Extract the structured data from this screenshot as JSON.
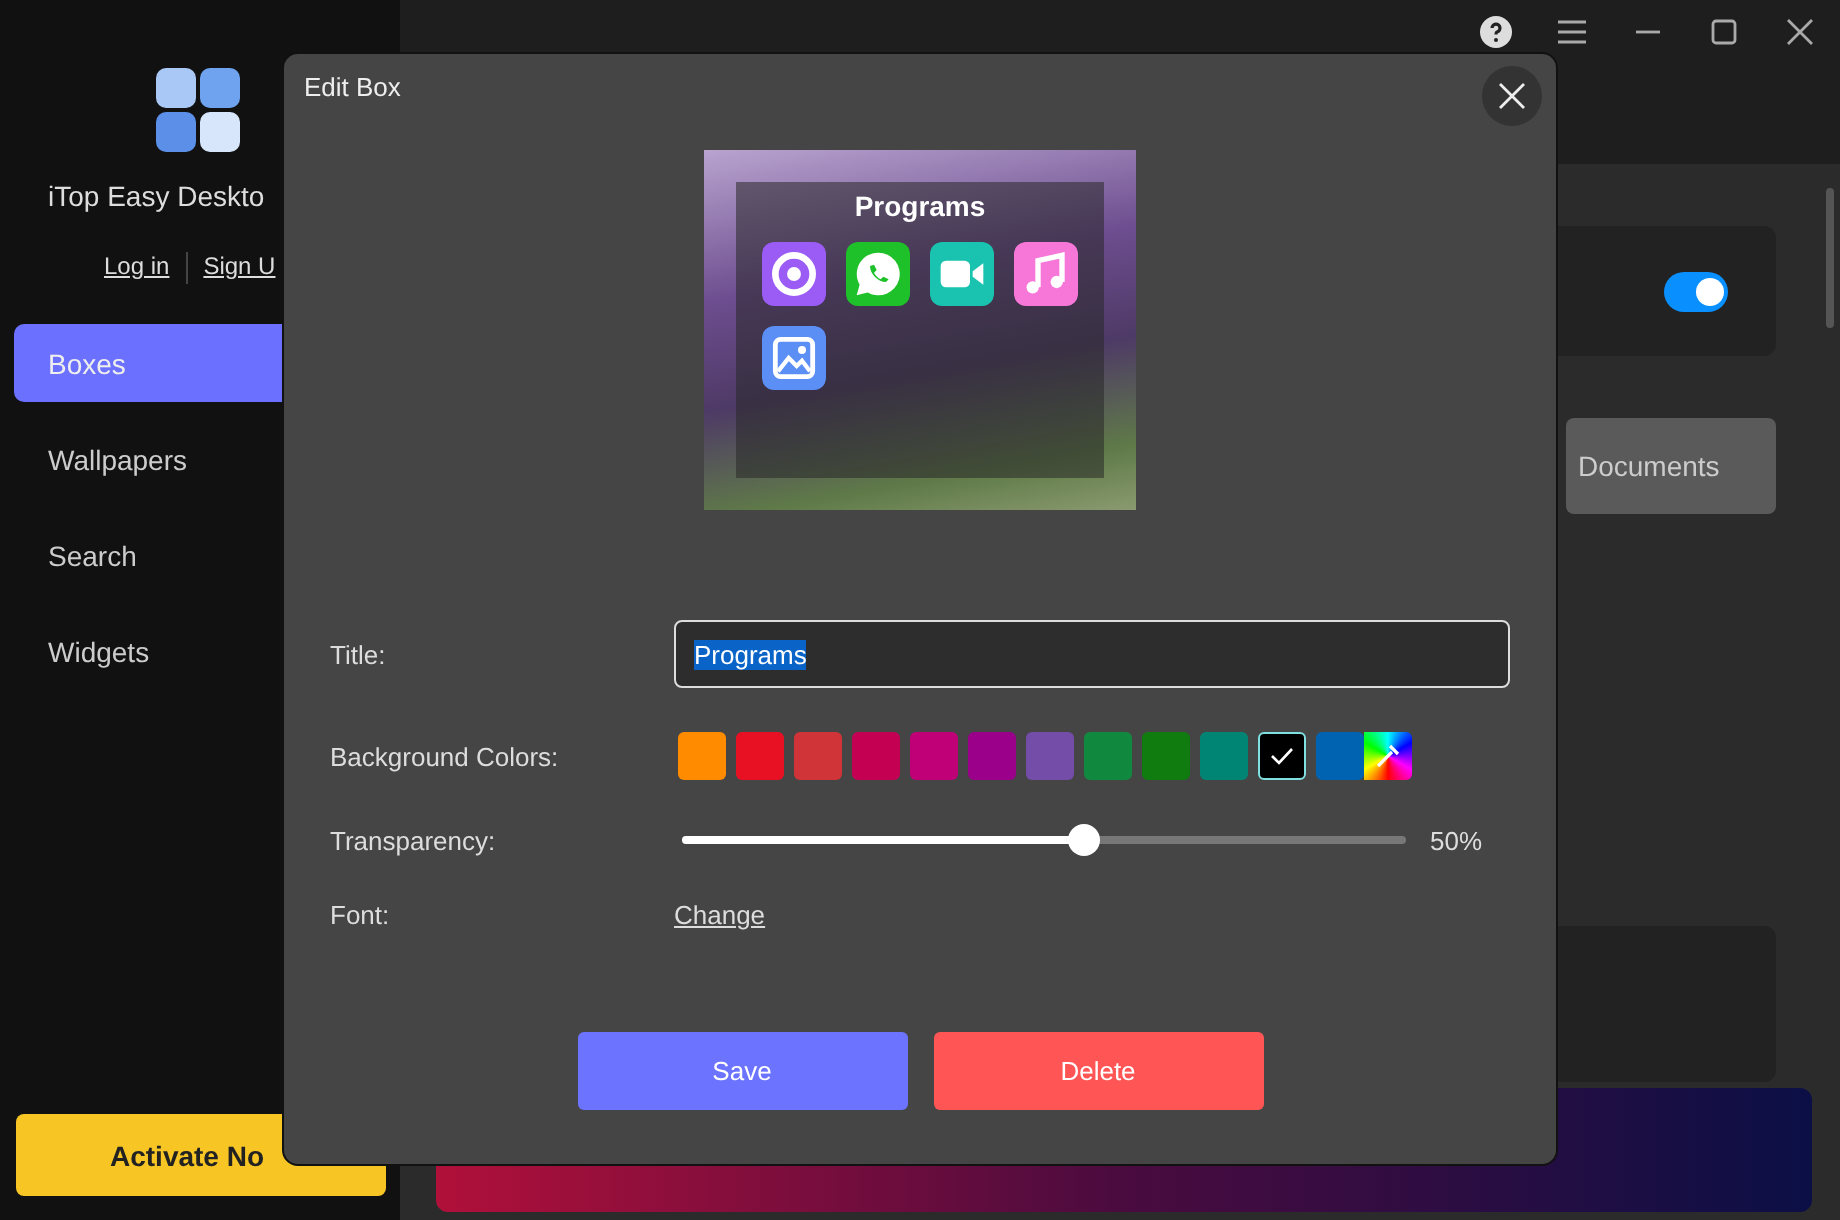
{
  "app": {
    "name": "iTop Easy Deskto",
    "login": "Log in",
    "signup": "Sign U",
    "nav": [
      {
        "label": "Boxes",
        "selected": true
      },
      {
        "label": "Wallpapers",
        "selected": false
      },
      {
        "label": "Search",
        "selected": false
      },
      {
        "label": "Widgets",
        "selected": false
      }
    ],
    "activate_button": "Activate No",
    "toggle": {
      "on": true
    },
    "documents_button": "Documents"
  },
  "dialog": {
    "title": "Edit Box",
    "preview": {
      "title": "Programs",
      "icons": [
        {
          "kind": "ring",
          "color": "#9b5cf5"
        },
        {
          "kind": "chat",
          "color": "#1fc12a"
        },
        {
          "kind": "video",
          "color": "#19c3b0"
        },
        {
          "kind": "music",
          "color": "#f777d9"
        },
        {
          "kind": "picture",
          "color": "#5b8ff5"
        }
      ]
    },
    "title_label": "Title:",
    "title_value": "Programs",
    "title_text_selected": true,
    "colors_label": "Background Colors:",
    "swatches": [
      {
        "kind": "solid",
        "color": "#ff8c00",
        "selected": false
      },
      {
        "kind": "solid",
        "color": "#e81123",
        "selected": false
      },
      {
        "kind": "solid",
        "color": "#d13438",
        "selected": false
      },
      {
        "kind": "solid",
        "color": "#c30052",
        "selected": false
      },
      {
        "kind": "solid",
        "color": "#bf0077",
        "selected": false
      },
      {
        "kind": "solid",
        "color": "#9a0089",
        "selected": false
      },
      {
        "kind": "solid",
        "color": "#744da9",
        "selected": false
      },
      {
        "kind": "solid",
        "color": "#10893e",
        "selected": false
      },
      {
        "kind": "solid",
        "color": "#107c10",
        "selected": false
      },
      {
        "kind": "solid",
        "color": "#008575",
        "selected": false
      },
      {
        "kind": "solid",
        "color": "#000000",
        "selected": true
      },
      {
        "kind": "solid",
        "color": "#0063b1",
        "selected": false
      },
      {
        "kind": "picker",
        "selected": false
      }
    ],
    "transparency_label": "Transparency:",
    "transparency": {
      "level": 0.555,
      "reading": "50%"
    },
    "font_label": "Font:",
    "font_link": "Change",
    "buttons": [
      {
        "kind": "primary",
        "label": "Save"
      },
      {
        "kind": "danger",
        "label": "Delete"
      }
    ]
  }
}
